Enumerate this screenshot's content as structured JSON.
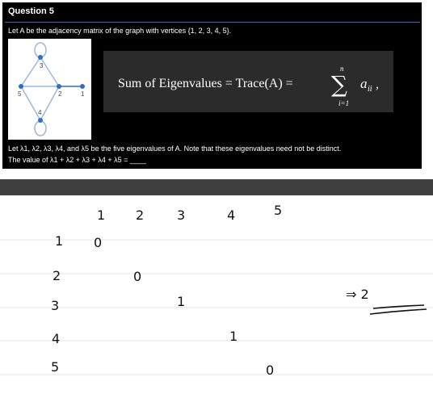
{
  "question": {
    "title": "Question 5",
    "intro": "Let A be the adjacency matrix of the graph with vertices {1, 2, 3, 4, 5}.",
    "line1": "Let λ1, λ2, λ3, λ4, and λ5 be the five eigenvalues of A. Note that these eigenvalues need not be distinct.",
    "line2": "The value of λ1 + λ2 + λ3 + λ4 + λ5 = ____"
  },
  "graph": {
    "vertex_labels": [
      "3",
      "5",
      "2",
      "1",
      "4"
    ]
  },
  "formula": {
    "lhs": "Sum of Eigenvalues = Trace(A) =",
    "sum_upper": "n",
    "sum_lower": "i=1",
    "term": "a",
    "subscript": "ii",
    "tail": ","
  },
  "notes": {
    "column_headers": [
      "1",
      "2",
      "3",
      "4",
      "5"
    ],
    "row_headers": [
      "1",
      "2",
      "3",
      "4",
      "5"
    ],
    "diagonal": [
      "0",
      "0",
      "1",
      "1",
      "0"
    ],
    "result": "⇒ 2"
  },
  "colors": {
    "panel": "#000000",
    "formula_bg": "#2b2b2b",
    "divider": "#404040",
    "rule": "#2f6fbf",
    "vertex": "#2f6fbf",
    "edge": "#9ab8dc",
    "notebook_line": "#e4e4e4",
    "ink": "#111111"
  }
}
